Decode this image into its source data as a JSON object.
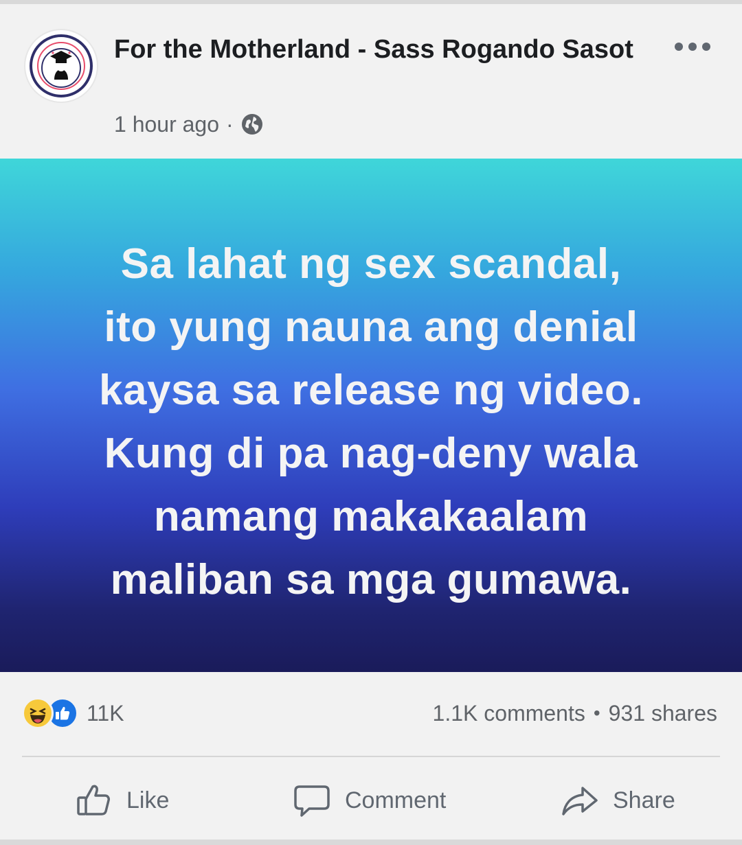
{
  "post": {
    "page_name": "For the Motherland - Sass Rogando Sasot",
    "timestamp": "1 hour ago",
    "meta_separator": "·",
    "privacy_icon": "globe-icon",
    "banner_lines": [
      "Sa lahat ng sex scandal,",
      "ito yung nauna ang denial",
      "kaysa sa release ng video.",
      "Kung di pa nag-deny wala",
      "namang makakaalam",
      "maliban sa mga gumawa."
    ],
    "banner_colors": [
      "#3fd6d9",
      "#3f6fe2",
      "#1a1b5a"
    ]
  },
  "stats": {
    "reaction_icons": [
      "haha-emoji-icon",
      "thumbs-up-icon"
    ],
    "reactions_count": "11K",
    "comments": "1.1K comments",
    "separator": "•",
    "shares": "931 shares"
  },
  "actions": {
    "like_label": "Like",
    "comment_label": "Comment",
    "share_label": "Share"
  },
  "colors": {
    "accent": "#1b74e4",
    "text_primary": "#1c1e21",
    "text_secondary": "#5f6368"
  }
}
